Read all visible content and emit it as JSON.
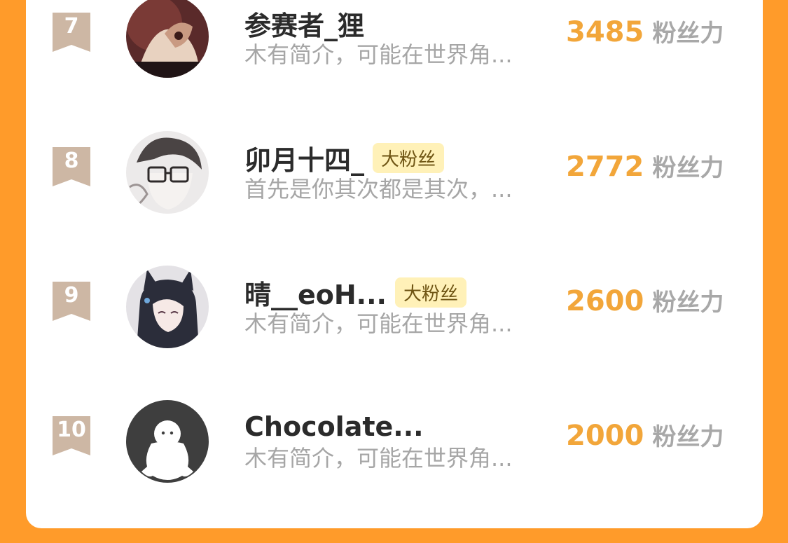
{
  "colors": {
    "background": "#FF9B2A",
    "card": "#FFFFFF",
    "rank_badge": "#CDB7A4",
    "score": "#F2A63A",
    "badge_bg": "#FFF1B8"
  },
  "leaderboard": {
    "entries": [
      {
        "rank": "7",
        "name": "参赛者_狸",
        "badge": "",
        "bio": "木有简介，可能在世界角...",
        "score": "3485",
        "score_unit": "粉丝力",
        "avatar": "illustrated-avatar"
      },
      {
        "rank": "8",
        "name": "卯月十四_",
        "badge": "大粉丝",
        "bio": "首先是你其次都是其次，...",
        "score": "2772",
        "score_unit": "粉丝力",
        "avatar": "glasses-character-avatar"
      },
      {
        "rank": "9",
        "name": "晴__eoH...",
        "badge": "大粉丝",
        "bio": "木有简介，可能在世界角...",
        "score": "2600",
        "score_unit": "粉丝力",
        "avatar": "anime-girl-avatar"
      },
      {
        "rank": "10",
        "name": "Chocolate...",
        "badge": "",
        "bio": "木有简介，可能在世界角...",
        "score": "2000",
        "score_unit": "粉丝力",
        "avatar": "default-avatar"
      }
    ]
  }
}
